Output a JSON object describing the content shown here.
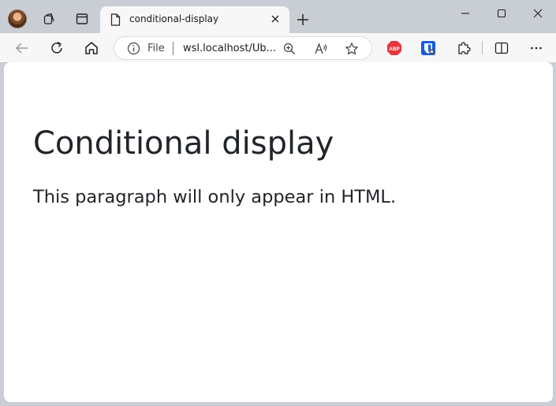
{
  "browser": {
    "tab_title": "conditional-display",
    "address": {
      "scheme_label": "File",
      "url_display": "wsl.localhost/Ub..."
    },
    "extension_badge": "ABP",
    "colors": {
      "frame": "#c9cdd4",
      "toolbar": "#f7f7f7",
      "abp_red": "#e8383d",
      "bitwarden_blue": "#175ddc"
    }
  },
  "page": {
    "heading": "Conditional display",
    "paragraph": "This paragraph will only appear in HTML."
  },
  "icons": {
    "profile": "avatar",
    "collections": "collections-icon",
    "tab_actions": "tab-actions-icon",
    "document": "document-icon",
    "close": "close-icon",
    "new_tab": "plus-icon",
    "minimize": "minimize-icon",
    "maximize": "maximize-icon",
    "window_close": "window-close-icon",
    "back": "back-arrow-icon",
    "refresh": "refresh-icon",
    "home": "home-icon",
    "info": "info-icon",
    "zoom": "zoom-icon",
    "read_aloud": "read-aloud-icon",
    "favorite": "star-icon",
    "adblock": "abp-icon",
    "bitwarden": "bitwarden-icon",
    "extensions": "puzzle-icon",
    "split_screen": "split-screen-icon",
    "more": "more-icon"
  }
}
